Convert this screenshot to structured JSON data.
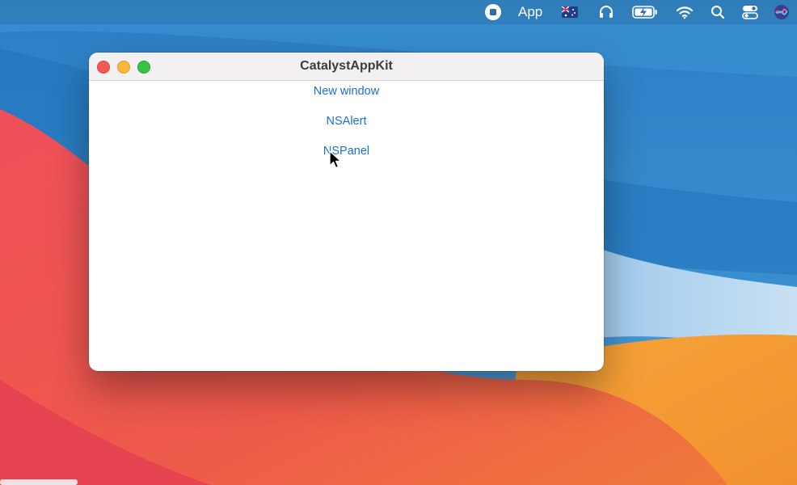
{
  "menubar": {
    "app_text": "App",
    "icons": [
      "stop-record-icon",
      "australia-flag-icon",
      "headphones-icon",
      "battery-charging-icon",
      "wifi-icon",
      "search-icon",
      "control-center-icon",
      "siri-icon"
    ]
  },
  "window": {
    "title": "CatalystAppKit",
    "buttons": [
      {
        "label": "New window"
      },
      {
        "label": "NSAlert"
      },
      {
        "label": "NSPanel"
      }
    ]
  },
  "colors": {
    "link": "#1a6fd4",
    "close": "#f25a55",
    "minimize": "#f5b83a",
    "zoom": "#37c342"
  }
}
